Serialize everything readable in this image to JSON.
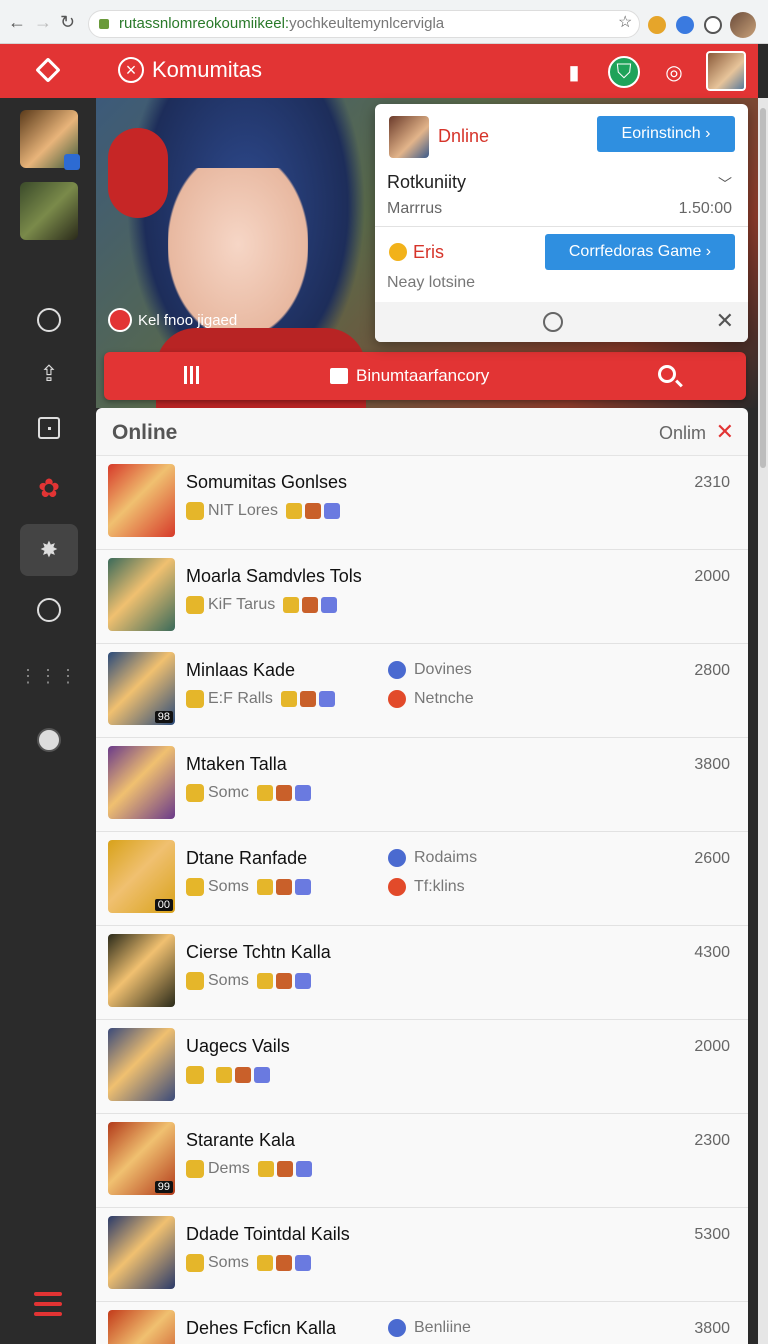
{
  "browser": {
    "url_main": "rutassnlomreokoumiikeel:",
    "url_rest": "yochkeultemynlcervigla"
  },
  "header": {
    "title": "Komumitas"
  },
  "hero": {
    "tag_label": "Kel fnoo jigaed"
  },
  "toolbar": {
    "center_label": "Binumtaarfancory"
  },
  "popup": {
    "status": "Dnline",
    "button_primary": "Eorinstinch ›",
    "row_title": "Rotkuniity",
    "row_sub": "Marrrus",
    "row_value": "1.50:00",
    "eris_label": "Eris",
    "button_game": "Corrfedoras Game ›",
    "eris_sub": "Neay lotsine"
  },
  "list": {
    "title": "Online",
    "filter": "Onlim",
    "rows": [
      {
        "name": "Somumitas Gonlses",
        "sub": "NIT Lores",
        "mid_top": "",
        "mid_bottom": "",
        "score": "2310",
        "level": "",
        "thumb": "#d63a2a"
      },
      {
        "name": "Moarla Samdvles Tols",
        "sub": "KiF Tarus",
        "mid_top": "",
        "mid_bottom": "",
        "score": "2000",
        "level": "",
        "thumb": "#3a6a5a"
      },
      {
        "name": "Minlaas Kade",
        "sub": "E:F Ralls",
        "mid_top": "Dovines",
        "mid_bottom": "Netnche",
        "score": "2800",
        "level": "98",
        "thumb": "#2a4a7a"
      },
      {
        "name": "Mtaken Talla",
        "sub": "Somc",
        "mid_top": "",
        "mid_bottom": "",
        "score": "3800",
        "level": "",
        "thumb": "#6a3a8a"
      },
      {
        "name": "Dtane Ranfade",
        "sub": "Soms",
        "mid_top": "Rodaims",
        "mid_bottom": "Tf:klins",
        "score": "2600",
        "level": "00",
        "thumb": "#d8a21a"
      },
      {
        "name": "Cierse Tchtn Kalla",
        "sub": "Soms",
        "mid_top": "",
        "mid_bottom": "",
        "score": "4300",
        "level": "",
        "thumb": "#2a2a1a"
      },
      {
        "name": "Uagecs Vails",
        "sub": "",
        "mid_top": "",
        "mid_bottom": "",
        "score": "2000",
        "level": "",
        "thumb": "#3a4a7a"
      },
      {
        "name": "Starante Kala",
        "sub": "Dems",
        "mid_top": "",
        "mid_bottom": "",
        "score": "2300",
        "level": "99",
        "thumb": "#b23a1a"
      },
      {
        "name": "Ddade Tointdal Kails",
        "sub": "Soms",
        "mid_top": "",
        "mid_bottom": "",
        "score": "5300",
        "level": "",
        "thumb": "#2a3a6a"
      },
      {
        "name": "Dehes Fcficn Kalla",
        "sub": "",
        "mid_top": "Benliine",
        "mid_bottom": "",
        "score": "3800",
        "level": "",
        "thumb": "#c23a1a"
      }
    ]
  },
  "colors": {
    "accent": "#e23434",
    "button_blue": "#2f8fe0",
    "shield_green": "#1fa35a"
  }
}
